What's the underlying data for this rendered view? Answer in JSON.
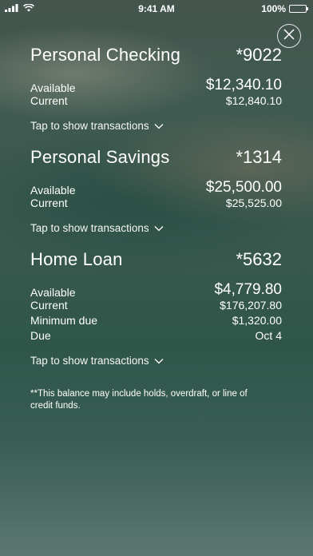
{
  "status": {
    "time": "9:41 AM",
    "battery": "100%"
  },
  "accounts": [
    {
      "name": "Personal Checking",
      "number": "*9022",
      "rows": [
        {
          "label": "Available",
          "value": "$12,340.10"
        },
        {
          "label": "Current",
          "value": "$12,840.10"
        }
      ],
      "tap": "Tap to show transactions"
    },
    {
      "name": "Personal Savings",
      "number": "*1314",
      "rows": [
        {
          "label": "Available",
          "value": "$25,500.00"
        },
        {
          "label": "Current",
          "value": "$25,525.00"
        }
      ],
      "tap": "Tap to show transactions"
    },
    {
      "name": "Home Loan",
      "number": "*5632",
      "rows": [
        {
          "label": "Available",
          "value": "$4,779.80"
        },
        {
          "label": "Current",
          "value": "$176,207.80"
        },
        {
          "label": "Minimum due",
          "value": "$1,320.00"
        },
        {
          "label": "Due",
          "value": "Oct 4"
        }
      ],
      "tap": "Tap to show transactions"
    }
  ],
  "footnote": "**This balance may include holds, overdraft, or line of credit funds."
}
